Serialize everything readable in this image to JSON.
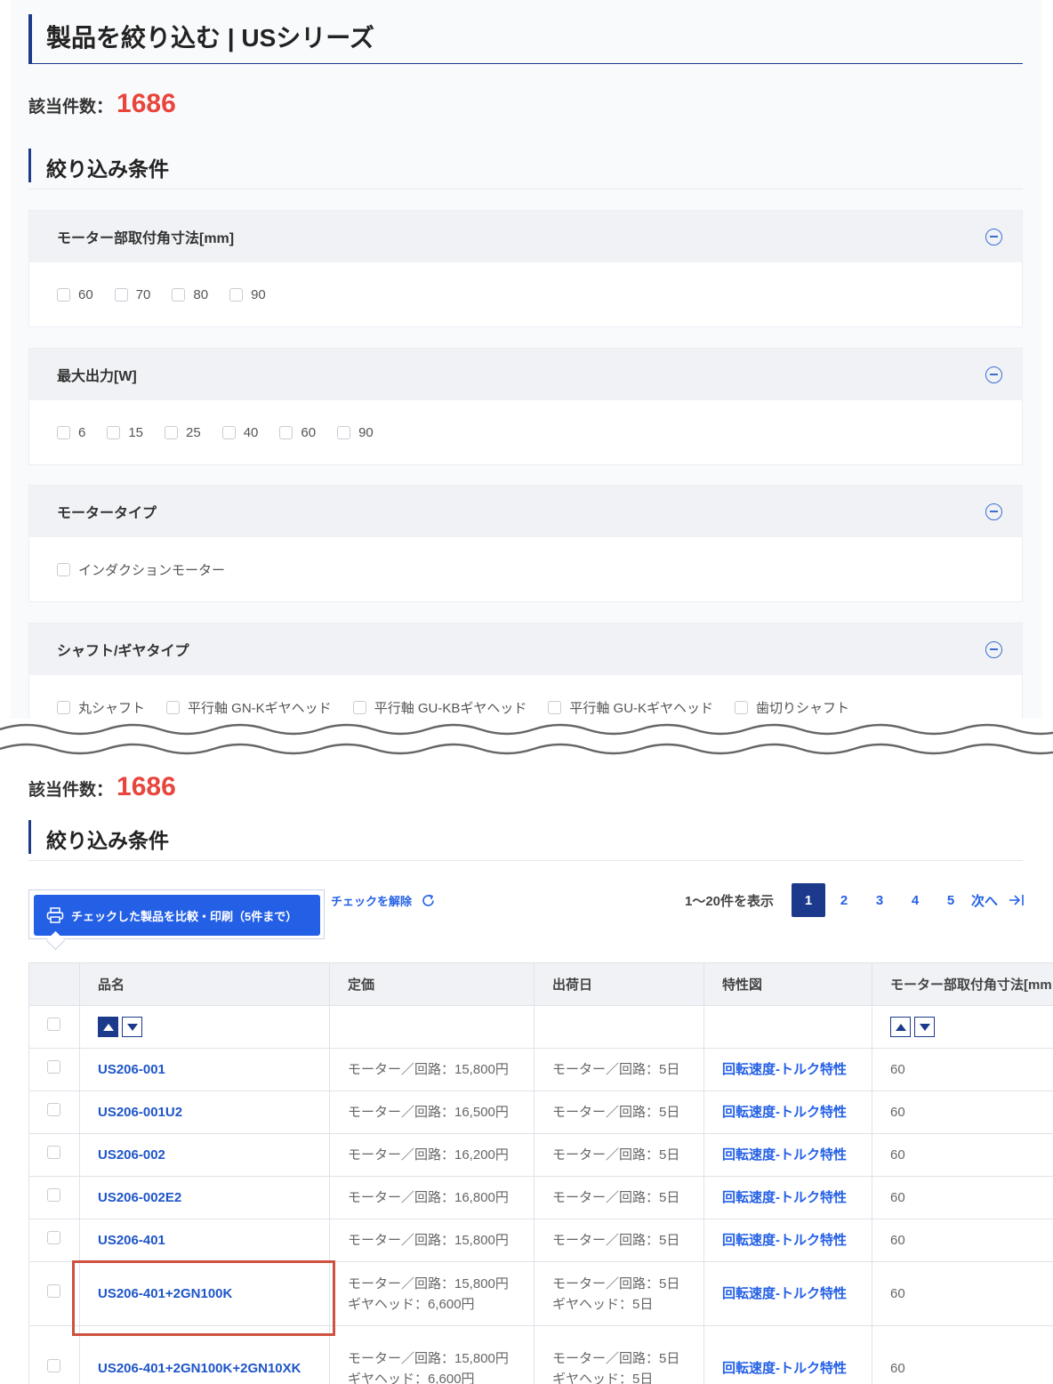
{
  "page_title": "製品を絞り込む | USシリーズ",
  "hit_count": {
    "label": "該当件数：",
    "value": "1686"
  },
  "filter_section_title": "絞り込み条件",
  "filters": [
    {
      "title": "モーター部取付角寸法[mm]",
      "options": [
        "60",
        "70",
        "80",
        "90"
      ]
    },
    {
      "title": "最大出力[W]",
      "options": [
        "6",
        "15",
        "25",
        "40",
        "60",
        "90"
      ]
    },
    {
      "title": "モータータイプ",
      "options": [
        "インダクションモーター"
      ]
    },
    {
      "title": "シャフト/ギヤタイプ",
      "options": [
        "丸シャフト",
        "平行軸 GN-Kギヤヘッド",
        "平行軸 GU-KBギヤヘッド",
        "平行軸 GU-Kギヤヘッド",
        "歯切りシャフト"
      ]
    }
  ],
  "toolbar": {
    "compare_label": "チェックした製品を比較・印刷（5件まで）",
    "uncheck_label": "チェックを解除",
    "range_text": "1〜20件を表示",
    "pages": [
      "1",
      "2",
      "3",
      "4",
      "5"
    ],
    "active_page": "1",
    "next_label": "次へ"
  },
  "table": {
    "headers": [
      "品名",
      "定価",
      "出荷日",
      "特性図",
      "モーター部取付角寸法[mm"
    ],
    "rows": [
      {
        "name": "US206-001",
        "price": [
          "モーター／回路：15,800円"
        ],
        "ship": [
          "モーター／回路：5日"
        ],
        "chart": "回転速度-トルク特性",
        "size": "60"
      },
      {
        "name": "US206-001U2",
        "price": [
          "モーター／回路：16,500円"
        ],
        "ship": [
          "モーター／回路：5日"
        ],
        "chart": "回転速度-トルク特性",
        "size": "60"
      },
      {
        "name": "US206-002",
        "price": [
          "モーター／回路：16,200円"
        ],
        "ship": [
          "モーター／回路：5日"
        ],
        "chart": "回転速度-トルク特性",
        "size": "60"
      },
      {
        "name": "US206-002E2",
        "price": [
          "モーター／回路：16,800円"
        ],
        "ship": [
          "モーター／回路：5日"
        ],
        "chart": "回転速度-トルク特性",
        "size": "60"
      },
      {
        "name": "US206-401",
        "price": [
          "モーター／回路：15,800円"
        ],
        "ship": [
          "モーター／回路：5日"
        ],
        "chart": "回転速度-トルク特性",
        "size": "60"
      },
      {
        "name": "US206-401+2GN100K",
        "price": [
          "モーター／回路：15,800円",
          "ギヤヘッド：6,600円"
        ],
        "ship": [
          "モーター／回路：5日",
          "ギヤヘッド：5日"
        ],
        "chart": "回転速度-トルク特性",
        "size": "60"
      },
      {
        "name": "US206-401+2GN100K+2GN10XK",
        "price": [
          "モーター／回路：15,800円",
          "ギヤヘッド：6,600円"
        ],
        "ship": [
          "モーター／回路：5日",
          "ギヤヘッド：5日"
        ],
        "chart": "回転速度-トルク特性",
        "size": "60"
      }
    ]
  },
  "colors": {
    "accent": "#2460e6",
    "navy": "#1c3a8c",
    "count_red": "#e8453c",
    "highlight": "#cf5140"
  },
  "icons": [
    "minus-circle-icon",
    "printer-icon",
    "refresh-icon",
    "last-page-icon",
    "sort-asc-icon",
    "sort-desc-icon"
  ]
}
